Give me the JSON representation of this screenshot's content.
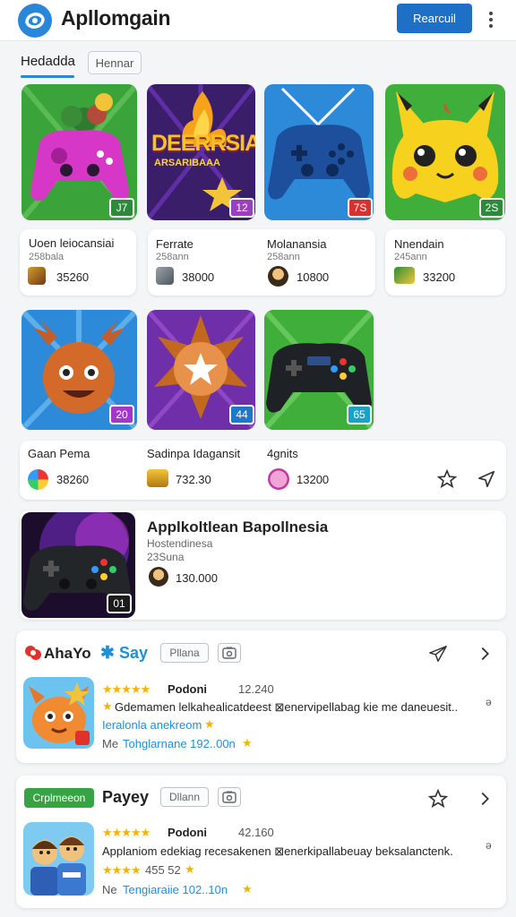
{
  "header": {
    "app_title": "Apllomgain",
    "action_button": "Rearcuil",
    "menu_icon": "kebab-icon"
  },
  "tabs": {
    "active": "Hedadda",
    "chip": "Hennar"
  },
  "games": [
    {
      "name": "Uoen leiocansiai",
      "sub": "258bala",
      "count": "35260",
      "badge": "J7",
      "badge_color": "#2c8a3a"
    },
    {
      "name": "Ferrate",
      "sub": "258ann",
      "count": "38000",
      "badge": "12",
      "badge_color": "#9b3fbf",
      "title_art": "DEERRSIA",
      "art_sub": "ARSARIBAAA"
    },
    {
      "name": "Molanansia",
      "sub": "258ann",
      "count": "10800",
      "badge": "7S",
      "badge_color": "#d6322f"
    },
    {
      "name": "Nnendain",
      "sub": "245ann",
      "count": "33200",
      "badge": "2S",
      "badge_color": "#2c8a3a"
    },
    {
      "name": "Gaan Pema",
      "count": "38260",
      "badge": "20",
      "badge_color": "#a436c9"
    },
    {
      "name": "Sadinpa Idagansit",
      "count": "732.30",
      "badge": "44",
      "badge_color": "#1f77c9"
    },
    {
      "name": "4gnits",
      "count": "13200",
      "badge": "65",
      "badge_color": "#1aa3c9"
    }
  ],
  "featured": {
    "title": "Applkoltlean Bapollnesia",
    "sub1": "Hostendinesa",
    "sub2": "23Suna",
    "count": "130.000",
    "badge": "01"
  },
  "review_cards": [
    {
      "brand1": "AhaYo",
      "brand2": "Say",
      "chip": "Pllana",
      "rating_name": "Podoni",
      "rating_count": "12.240",
      "desc": "Gdemamen lelkahealicatdeest ⊠enervipellabag kie me daneuesit..",
      "link": "Ieralonla anekreom",
      "meta_prefix": "Me",
      "meta": "Tohglarnane 192..00n",
      "side": "ə"
    },
    {
      "green_chip": "Crplmeeon",
      "brand": "Payey",
      "chip": "Dllann",
      "rating_name": "Podoni",
      "rating_count": "42.160",
      "desc": "Applaniom edekiag recesakenen ⊠enerkipallabeuay beksalanctenk.",
      "rating_line": "455 52",
      "meta_prefix": "Ne",
      "meta": "Tengiaraiie 102..10n",
      "side": "ə"
    }
  ],
  "colors": {
    "accent": "#1e6fc6",
    "star": "#f3b400",
    "link": "#1f8fd6"
  }
}
